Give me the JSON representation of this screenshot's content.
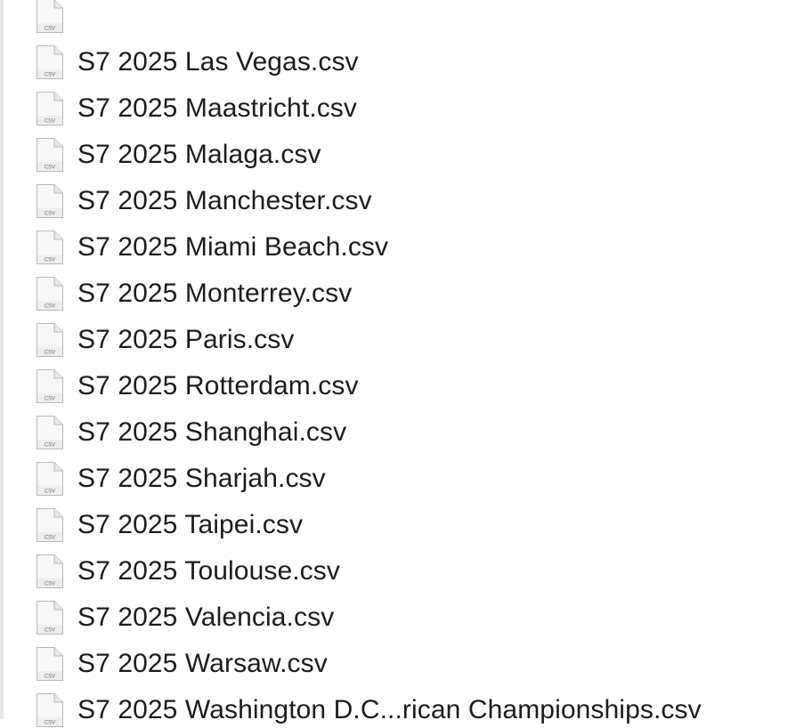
{
  "file_type_icon_label": "CSV",
  "files": [
    {
      "name": ""
    },
    {
      "name": "S7 2025 Las Vegas.csv"
    },
    {
      "name": "S7 2025 Maastricht.csv"
    },
    {
      "name": "S7 2025 Malaga.csv"
    },
    {
      "name": "S7 2025 Manchester.csv"
    },
    {
      "name": "S7 2025 Miami Beach.csv"
    },
    {
      "name": "S7 2025 Monterrey.csv"
    },
    {
      "name": "S7 2025 Paris.csv"
    },
    {
      "name": "S7 2025 Rotterdam.csv"
    },
    {
      "name": "S7 2025 Shanghai.csv"
    },
    {
      "name": "S7 2025 Sharjah.csv"
    },
    {
      "name": "S7 2025 Taipei.csv"
    },
    {
      "name": "S7 2025 Toulouse.csv"
    },
    {
      "name": "S7 2025 Valencia.csv"
    },
    {
      "name": "S7 2025 Warsaw.csv"
    },
    {
      "name": "S7 2025 Washington D.C...rican Championships.csv"
    }
  ]
}
